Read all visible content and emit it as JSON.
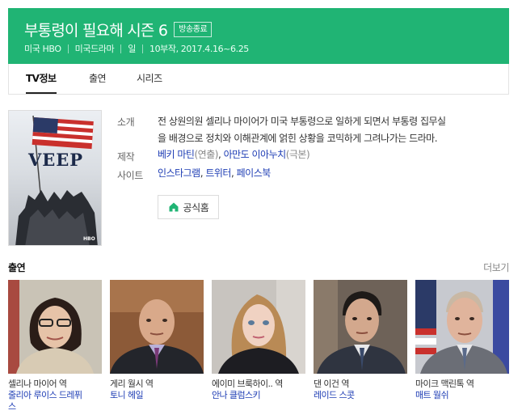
{
  "show": {
    "title": "부통령이 필요해 시즌 6",
    "badge": "방송종료",
    "meta": [
      "미국 HBO",
      "미국드라마",
      "일",
      "10부작, 2017.4.16~6.25"
    ]
  },
  "tabs": [
    "TV정보",
    "출연",
    "시리즈"
  ],
  "poster": {
    "logo": "VEEP",
    "network": "HBO"
  },
  "info": {
    "summary_label": "소개",
    "summary_line1": "전 상원의원 셀리나 마이어가 미국 부통령으로 일하게 되면서 부통령 집무실",
    "summary_line2": "을 배경으로 정치와 이해관계에 얽힌 상황을 코믹하게 그려나가는 드라마.",
    "production_label": "제작",
    "producer1": "베키 마틴",
    "producer1_role": "(연출)",
    "producer_sep": ", ",
    "producer2": "아만도 이아누치",
    "producer2_role": "(극본)",
    "site_label": "사이트",
    "site1": "인스타그램",
    "site2": "트위터",
    "site3": "페이스북",
    "site_sep": ", ",
    "homepage_label": "공식홈"
  },
  "cast_section": {
    "title": "출연",
    "more": "더보기"
  },
  "cast": [
    {
      "role": "셀리나 마이어 역",
      "actor_line1": "줄리아 루이스 드레퓌",
      "actor_line2": "스"
    },
    {
      "role": "게리 월시 역",
      "actor_line1": "토니 헤일",
      "actor_line2": ""
    },
    {
      "role": "에이미 브룩하이.. 역",
      "actor_line1": "안나 클럼스키",
      "actor_line2": ""
    },
    {
      "role": "댄 이건 역",
      "actor_line1": "레이드 스콧",
      "actor_line2": ""
    },
    {
      "role": "마이크 맥린톡 역",
      "actor_line1": "매트 월쉬",
      "actor_line2": ""
    }
  ],
  "colors": {
    "header_green": "#20b474",
    "link_blue": "#1d3cb4"
  }
}
